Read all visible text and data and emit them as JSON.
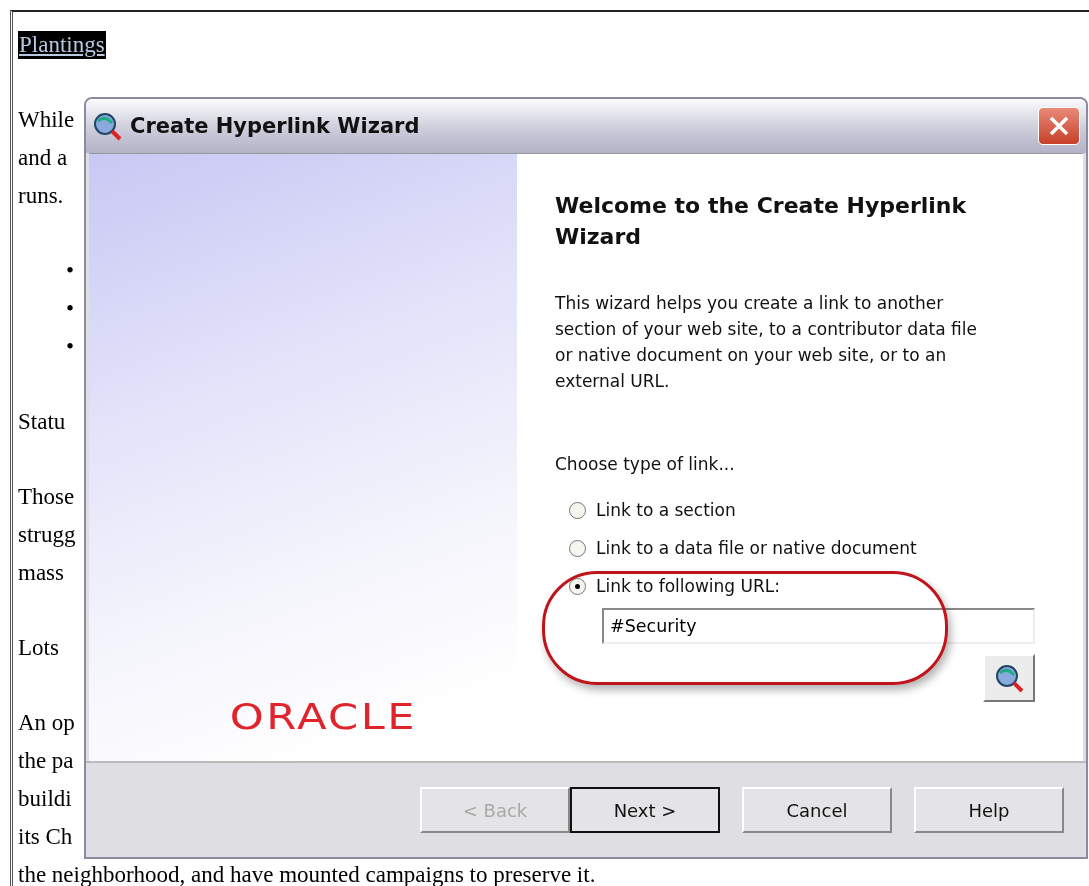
{
  "document": {
    "heading": "Plantings",
    "blocks": [
      {
        "kind": "paragraph",
        "lines": [
          "While",
          "and a",
          "runs."
        ]
      },
      {
        "kind": "bullets",
        "items": [
          {
            "marker": "•"
          },
          {
            "marker": "•"
          },
          {
            "marker": "•"
          }
        ]
      },
      {
        "kind": "paragraph",
        "lines": [
          "Statu"
        ]
      },
      {
        "kind": "paragraph",
        "lines": [
          "Those",
          "strugg",
          "mass"
        ]
      },
      {
        "kind": "paragraph",
        "lines": [
          "Lots"
        ]
      },
      {
        "kind": "paragraph",
        "lines": [
          "An op",
          "the pa",
          "buildi",
          "its Ch",
          "the neighborhood, and have mounted campaigns to preserve it."
        ]
      }
    ]
  },
  "dialog": {
    "title": "Create Hyperlink Wizard",
    "logo": "ORACLE",
    "heading": "Welcome to the Create Hyperlink Wizard",
    "description": "This wizard helps you create a link to another section of your web site, to a contributor data file or native document on your web site, or to an external URL.",
    "prompt": "Choose type of link...",
    "options": [
      {
        "label": "Link to a section",
        "selected": false
      },
      {
        "label": "Link to a data file or native document",
        "selected": false
      },
      {
        "label": "Link to following URL:",
        "selected": true
      }
    ],
    "url": {
      "value": "#Security"
    },
    "buttons": [
      {
        "label": "< Back",
        "disabled": true,
        "default": false
      },
      {
        "label": "Next >",
        "disabled": false,
        "default": true
      },
      {
        "label": "Cancel",
        "disabled": false,
        "default": false
      },
      {
        "label": "Help",
        "disabled": false,
        "default": false
      }
    ]
  }
}
